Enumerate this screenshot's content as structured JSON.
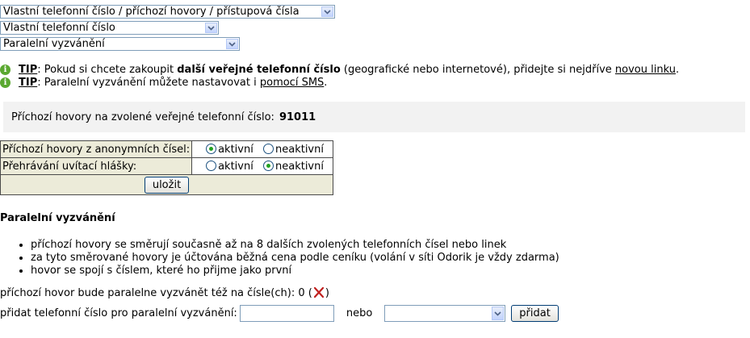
{
  "selects": {
    "category": {
      "value": "Vlastní telefonní číslo / příchozí hovory / přístupová čísla"
    },
    "number": {
      "value": "Vlastní telefonní číslo"
    },
    "feature": {
      "value": "Paralelní vyzvánění"
    }
  },
  "tips": [
    {
      "label": "TIP",
      "pre": ": Pokud si chcete zakoupit ",
      "bold": "další veřejné telefonní číslo",
      "post": " (geografické nebo internetové), přidejte si nejdříve ",
      "link": "novou linku",
      "end": "."
    },
    {
      "label": "TIP",
      "pre": ": Paralelní vyzvánění můžete nastavovat i ",
      "link": "pomocí SMS",
      "end": "."
    }
  ],
  "incoming": {
    "label": "Příchozí hovory na zvolené veřejné telefonní číslo:",
    "number": "91011"
  },
  "settings": {
    "rows": [
      {
        "label": "Příchozí hovory z anonymních čísel:",
        "opt1": "aktivní",
        "opt2": "neaktivní",
        "selected": "aktivní"
      },
      {
        "label": "Přehrávání uvítací hlášky:",
        "opt1": "aktivní",
        "opt2": "neaktivní",
        "selected": "neaktivní"
      }
    ],
    "save_label": "uložit"
  },
  "section": {
    "title": "Paralelní vyzvánění",
    "bullets": [
      "příchozí hovory se směrují současně až na 8 dalších zvolených telefonních čísel nebo linek",
      "za tyto směrované hovory je účtována běžná cena podle ceníku (volání v síti Odorik je vždy zdarma)",
      "hovor se spojí s číslem, které ho přijme jako první"
    ]
  },
  "parallel": {
    "count_text": "příchozí hovor bude paralelne vyzvánět též na čísle(ch): 0 (",
    "count_end": ")",
    "add_label": "přidat telefonní číslo pro paralelní vyzvánění:",
    "or_label": "nebo",
    "add_button": "přidat"
  },
  "colors": {
    "panel_bg": "#f2f2f2",
    "table_bg": "#ecebd9",
    "info_icon": "#5aa830",
    "delete_icon": "#c0201e"
  }
}
